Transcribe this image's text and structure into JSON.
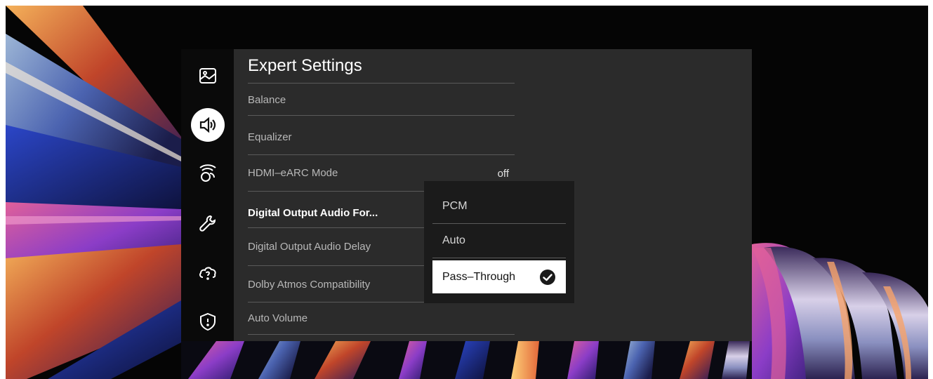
{
  "panel": {
    "title": "Expert Settings"
  },
  "sidebar": {
    "items": [
      {
        "icon": "picture-icon",
        "active": false
      },
      {
        "icon": "sound-icon",
        "active": true
      },
      {
        "icon": "network-icon",
        "active": false
      },
      {
        "icon": "wrench-icon",
        "active": false
      },
      {
        "icon": "cloud-help-icon",
        "active": false
      },
      {
        "icon": "shield-icon",
        "active": false
      }
    ]
  },
  "menu": {
    "items": [
      {
        "label": "Balance",
        "value": ""
      },
      {
        "label": "Equalizer",
        "value": ""
      },
      {
        "label": "HDMI–eARC Mode",
        "value": "off"
      },
      {
        "label": "Digital Output Audio For...",
        "value": ""
      },
      {
        "label": "Digital Output Audio Delay",
        "value": ""
      },
      {
        "label": "Dolby Atmos Compatibility",
        "value": ""
      },
      {
        "label": "Auto Volume",
        "value": ""
      }
    ],
    "focused_index": 3
  },
  "dropdown": {
    "options": [
      "PCM",
      "Auto",
      "Pass–Through"
    ],
    "selected": "Pass–Through"
  },
  "colors": {
    "panel_bg": "#2b2b2b",
    "sidebar_bg": "#0a0a0a",
    "dropdown_bg": "#1b1b1b",
    "selected_bg": "#ffffff",
    "text_primary": "#ffffff",
    "text_secondary": "#b8b8b8"
  }
}
